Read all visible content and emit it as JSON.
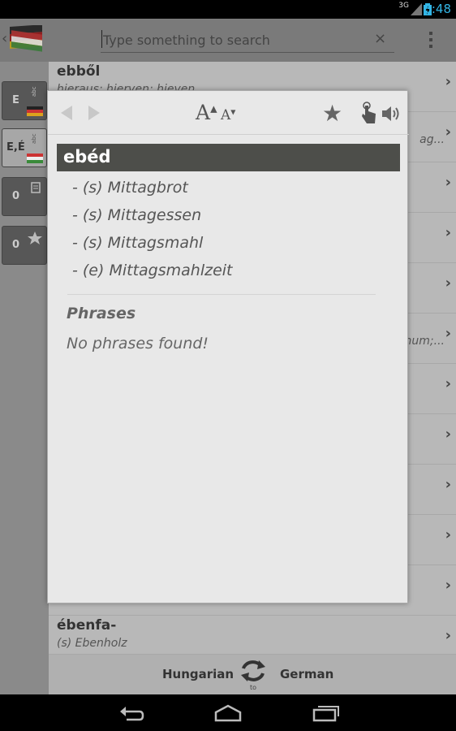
{
  "status": {
    "network": "3G",
    "time": "8:48"
  },
  "actionbar": {
    "search_placeholder": "Type something to search",
    "clear_glyph": "×"
  },
  "side_filters": [
    {
      "label": "E"
    },
    {
      "label": "E,É"
    },
    {
      "label": "0"
    },
    {
      "label": "0"
    }
  ],
  "list": [
    {
      "word": "ebből",
      "translation": "hieraus; hierven; hieven",
      "trailing": ""
    },
    {
      "word": "",
      "translation": "",
      "trailing": "ag..."
    },
    {
      "word": "",
      "translation": "",
      "trailing": ""
    },
    {
      "word": "",
      "translation": "",
      "trailing": ""
    },
    {
      "word": "",
      "translation": "",
      "trailing": ""
    },
    {
      "word": "",
      "translation": "",
      "trailing": "num;..."
    },
    {
      "word": "",
      "translation": "",
      "trailing": ""
    },
    {
      "word": "",
      "translation": "",
      "trailing": ""
    },
    {
      "word": "",
      "translation": "",
      "trailing": ""
    },
    {
      "word": "",
      "translation": "",
      "trailing": ""
    },
    {
      "word": "",
      "translation": "",
      "trailing": ""
    },
    {
      "word": "ébenfa-",
      "translation": "(s) Ebenholz",
      "trailing": ""
    }
  ],
  "langbar": {
    "from": "Hungarian",
    "to": "German",
    "to_label": "to"
  },
  "dialog": {
    "font_up_glyph": "A",
    "font_down_glyph": "A",
    "headword": "ebéd",
    "meanings": [
      "- (s) Mittagbrot",
      "- (s) Mittagessen",
      "- (s) Mittagsmahl",
      "- (e) Mittagsmahlzeit"
    ],
    "phrases_title": "Phrases",
    "no_phrases": "No phrases found!"
  },
  "colors": {
    "accent_time": "#33b5e5",
    "headword_bg": "#4d4e4a",
    "dialog_bg": "#e8e8e8"
  }
}
